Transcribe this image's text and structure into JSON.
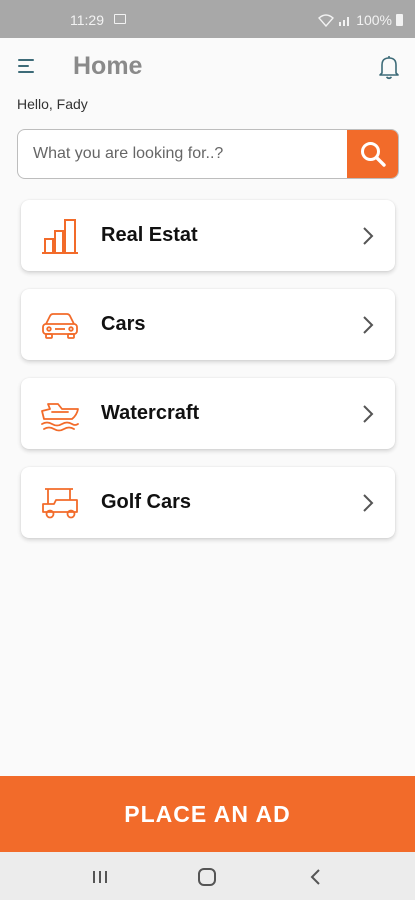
{
  "status_bar": {
    "time": "11:29",
    "battery": "100%",
    "icons": [
      "image-icon",
      "wifi-icon",
      "signal-icon",
      "battery-icon"
    ]
  },
  "header": {
    "title": "Home",
    "menu_icon": "hamburger-menu-icon",
    "notification_icon": "bell-icon"
  },
  "greeting": "Hello, Fady",
  "search": {
    "placeholder": "What you are looking for..?",
    "value": "",
    "button_icon": "search-icon"
  },
  "categories": [
    {
      "label": "Real Estat",
      "icon": "building-icon"
    },
    {
      "label": "Cars",
      "icon": "car-icon"
    },
    {
      "label": "Watercraft",
      "icon": "boat-icon"
    },
    {
      "label": "Golf Cars",
      "icon": "golf-cart-icon"
    }
  ],
  "cta": {
    "label": "PLACE AN AD"
  },
  "nav_bar": {
    "icons": [
      "recent-apps-icon",
      "home-icon",
      "back-icon"
    ]
  },
  "colors": {
    "accent": "#f26b2a",
    "title_gray": "#8a8a8a",
    "menu_teal": "#3d6b78",
    "background": "#fafafa",
    "status_bar": "#a8a8a8"
  }
}
